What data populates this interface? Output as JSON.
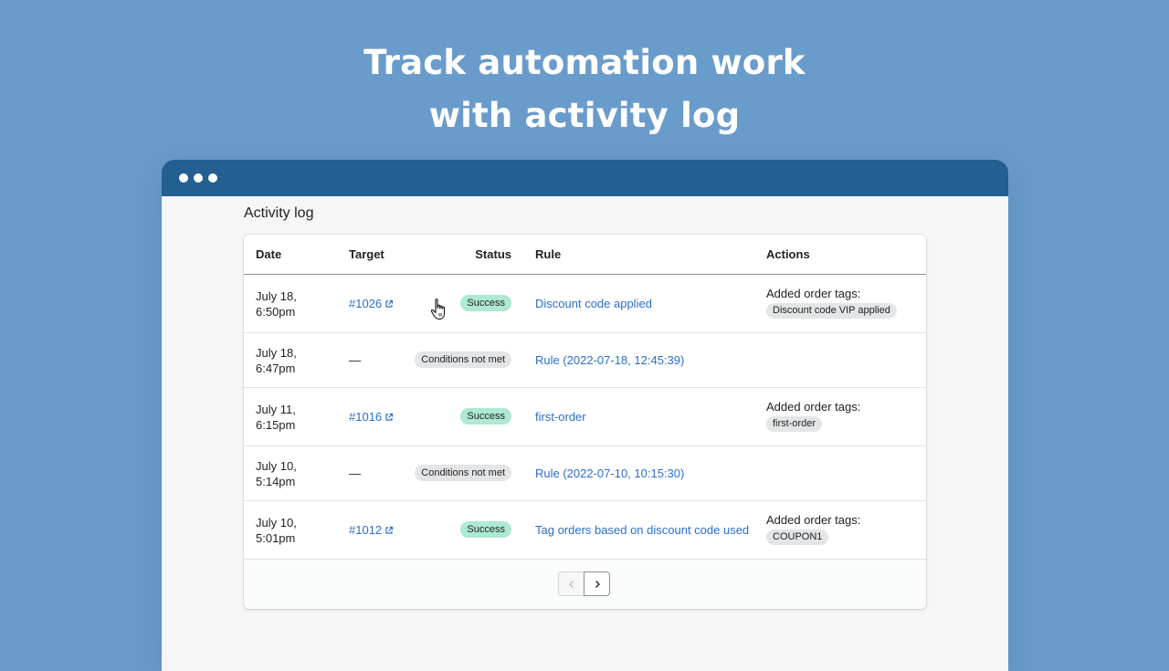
{
  "headline": {
    "line1": "Track automation work",
    "line2": "with activity log"
  },
  "page": {
    "title": "Activity log"
  },
  "table": {
    "headers": {
      "date": "Date",
      "target": "Target",
      "status": "Status",
      "rule": "Rule",
      "actions": "Actions"
    },
    "rows": [
      {
        "date_line1": "July 18,",
        "date_line2": "6:50pm",
        "target": "#1026",
        "target_link": true,
        "status": "Success",
        "status_type": "success",
        "rule": "Discount code applied",
        "action_label": "Added order tags:",
        "action_tag": "Discount code VIP applied"
      },
      {
        "date_line1": "July 18,",
        "date_line2": "6:47pm",
        "target": "—",
        "target_link": false,
        "status": "Conditions not met",
        "status_type": "neutral",
        "rule": "Rule (2022-07-18, 12:45:39)",
        "action_label": "",
        "action_tag": ""
      },
      {
        "date_line1": "July 11,",
        "date_line2": "6:15pm",
        "target": "#1016",
        "target_link": true,
        "status": "Success",
        "status_type": "success",
        "rule": "first-order",
        "action_label": "Added order tags:",
        "action_tag": "first-order"
      },
      {
        "date_line1": "July 10,",
        "date_line2": "5:14pm",
        "target": "—",
        "target_link": false,
        "status": "Conditions not met",
        "status_type": "neutral",
        "rule": "Rule (2022-07-10, 10:15:30)",
        "action_label": "",
        "action_tag": ""
      },
      {
        "date_line1": "July 10,",
        "date_line2": "5:01pm",
        "target": "#1012",
        "target_link": true,
        "status": "Success",
        "status_type": "success",
        "rule": "Tag orders based on discount code used",
        "action_label": "Added order tags:",
        "action_tag": "COUPON1"
      }
    ]
  },
  "pagination": {
    "prev_icon": "chevron-left-icon",
    "next_icon": "chevron-right-icon",
    "prev_disabled": true
  },
  "colors": {
    "background": "#6a9ccb",
    "titlebar": "#235f90",
    "link": "#2c6ecb",
    "success_badge": "#aee9d1",
    "neutral_badge": "#e4e5e7"
  }
}
